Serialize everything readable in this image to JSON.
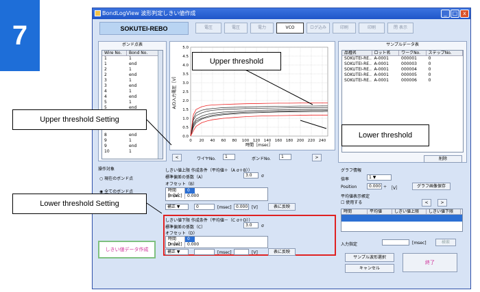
{
  "big_number": "7",
  "window": {
    "title": "BondLogView 波形判定しきい値作成",
    "app_name": "SOKUTEI-REBO",
    "min": "_",
    "max": "□",
    "close": "x"
  },
  "toolbar": {
    "buttons": [
      "電圧",
      "電圧",
      "電力",
      "VCO",
      "ログ込み",
      "印刷",
      "印刷",
      "閉 表示"
    ],
    "active_index": 3
  },
  "bond_list": {
    "title": "ボンド点表",
    "headers": [
      "Wire No.",
      "Bond No."
    ],
    "rows": [
      [
        "1",
        "1"
      ],
      [
        "1",
        "end"
      ],
      [
        "2",
        "1"
      ],
      [
        "2",
        "end"
      ],
      [
        "3",
        "1"
      ],
      [
        "3",
        "end"
      ],
      [
        "4",
        "1"
      ],
      [
        "4",
        "end"
      ],
      [
        "5",
        "1"
      ],
      [
        "5",
        "end"
      ]
    ],
    "rows_bottom": [
      [
        "8",
        "end"
      ],
      [
        "9",
        "1"
      ],
      [
        "9",
        "end"
      ],
      [
        "10",
        "1"
      ]
    ]
  },
  "chart": {
    "ylabel": "A/D入力電圧［V］",
    "xlabel": "時間［msec］",
    "yticks": [
      "5.0",
      "4.5",
      "4.0",
      "3.5",
      "3.0",
      "2.5",
      "2.0",
      "1.5",
      "1.0",
      "0.5",
      "0.0"
    ],
    "xticks": [
      "0",
      "20",
      "40",
      "60",
      "80",
      "100",
      "120",
      "140",
      "160",
      "180",
      "200",
      "220",
      "240"
    ]
  },
  "chart_data": {
    "type": "line",
    "xlabel": "時間［msec］",
    "ylabel": "A/D入力電圧［V］",
    "xlim": [
      0,
      250
    ],
    "ylim": [
      0,
      5.0
    ],
    "grid": true,
    "x": [
      0,
      5,
      10,
      20,
      30,
      40,
      60,
      80,
      100,
      120,
      140,
      160,
      180,
      200,
      220,
      240,
      250
    ],
    "series": [
      {
        "values": [
          0.0,
          0.9,
          1.15,
          1.3,
          1.4,
          1.45,
          1.5,
          1.52,
          1.55,
          1.56,
          1.57,
          1.58,
          1.59,
          1.6,
          1.6,
          1.61,
          1.61
        ]
      },
      {
        "values": [
          0.0,
          0.7,
          0.95,
          1.12,
          1.22,
          1.28,
          1.35,
          1.38,
          1.42,
          1.44,
          1.46,
          1.47,
          1.48,
          1.49,
          1.5,
          1.5,
          1.5
        ]
      },
      {
        "values": [
          0.0,
          0.6,
          0.85,
          1.0,
          1.1,
          1.18,
          1.25,
          1.3,
          1.34,
          1.36,
          1.38,
          1.4,
          1.41,
          1.42,
          1.43,
          1.43,
          1.44
        ]
      },
      {
        "values": [
          0.0,
          0.5,
          0.75,
          0.95,
          1.05,
          1.12,
          1.2,
          1.25,
          1.29,
          1.31,
          1.33,
          1.35,
          1.36,
          1.37,
          1.38,
          1.38,
          1.39
        ]
      },
      {
        "values": [
          0.0,
          1.0,
          1.3,
          1.45,
          1.52,
          1.55,
          1.6,
          1.62,
          1.64,
          1.65,
          1.66,
          1.67,
          1.68,
          1.69,
          1.69,
          1.7,
          1.7
        ]
      },
      {
        "values": [
          0.0,
          1.2,
          1.5,
          1.65,
          1.72,
          1.75,
          1.78,
          1.8,
          1.82,
          1.83,
          1.84,
          1.85,
          1.85,
          1.86,
          1.86,
          1.86,
          1.86
        ],
        "color": "#e22"
      },
      {
        "values": [
          0.0,
          0.3,
          0.55,
          0.75,
          0.85,
          0.92,
          1.0,
          1.05,
          1.09,
          1.12,
          1.14,
          1.15,
          1.16,
          1.17,
          1.18,
          1.18,
          1.18
        ],
        "color": "#e22"
      }
    ]
  },
  "chart_nav": {
    "prev": "<",
    "wire_label": "ワイヤNo.",
    "wire_value": "1",
    "bond_label": "ボンドNo.",
    "bond_value": "1",
    "next": ">"
  },
  "sample_list": {
    "title": "サンプルデータ表",
    "headers": [
      "品種名",
      "ロット名",
      "ワークNo.",
      "ステップNo."
    ],
    "rows": [
      [
        "SOKUTEI-RE..",
        "A-0001",
        "000001",
        "0"
      ],
      [
        "SOKUTEI-RE..",
        "A-0001",
        "000003",
        "0"
      ],
      [
        "SOKUTEI-RE..",
        "A-0001",
        "000004",
        "0"
      ],
      [
        "SOKUTEI-RE..",
        "A-0001",
        "000005",
        "0"
      ],
      [
        "SOKUTEI-RE..",
        "A-0001",
        "000006",
        "0"
      ]
    ],
    "delete": "削除"
  },
  "target": {
    "title": "操作対象",
    "opt1": "現在のボンド点",
    "opt2": "全てのボンド点"
  },
  "upper": {
    "title": "しきい値上限 作成条件（平均値＋（A σ＋B））",
    "coef_label": "標準偏差の係数（A）",
    "coef_value": "3.0",
    "sigma": "σ",
    "offset_label": "オフセット（B）",
    "time_label": "時間[msec]",
    "time_value": "0",
    "bv_label": "B［V］",
    "bv_value": "0.000",
    "mode": "補正",
    "from": "0",
    "unit_msec": "[msec]",
    "val": "0.000",
    "unit_v": "[V]",
    "apply": "表に反映"
  },
  "lower": {
    "title": "しきい値下限 作成条件（平均値－（C σ＋D））",
    "coef_label": "標準偏差の係数（C）",
    "coef_value": "3.0",
    "sigma": "σ",
    "offset_label": "オフセット（D）",
    "time_label": "時間[msec]",
    "time_value": "0",
    "dv_label": "D［V］",
    "dv_value": "0.000",
    "mode": "補正",
    "unit_msec": "[msec]",
    "unit_v": "[V]",
    "apply": "表に反映"
  },
  "graph_info": {
    "title": "グラフ情報",
    "scale_label": "倍率",
    "scale_value": "1",
    "position_label": "Position",
    "position_value": "0.000",
    "position_unit": "［V］",
    "save": "グラフ画像保存"
  },
  "avg_setting": {
    "title": "平均値表示帳定",
    "use": "使用する",
    "headers": [
      "時間",
      "平均値",
      "しきい値上限",
      "しきい値下限"
    ],
    "input_label": "入力指定",
    "unit": "[msec]",
    "search": "検索",
    "prev": "<",
    "next": ">"
  },
  "create_btn": "しきい値データ作成",
  "sample_select": "サンプル波形選択",
  "cancel": "キャンセル",
  "finish": "終了",
  "callouts": {
    "upper_threshold": "Upper threshold",
    "lower_threshold": "Lower threshold",
    "upper_setting": "Upper threshold Setting",
    "lower_setting": "Lower threshold Setting"
  }
}
